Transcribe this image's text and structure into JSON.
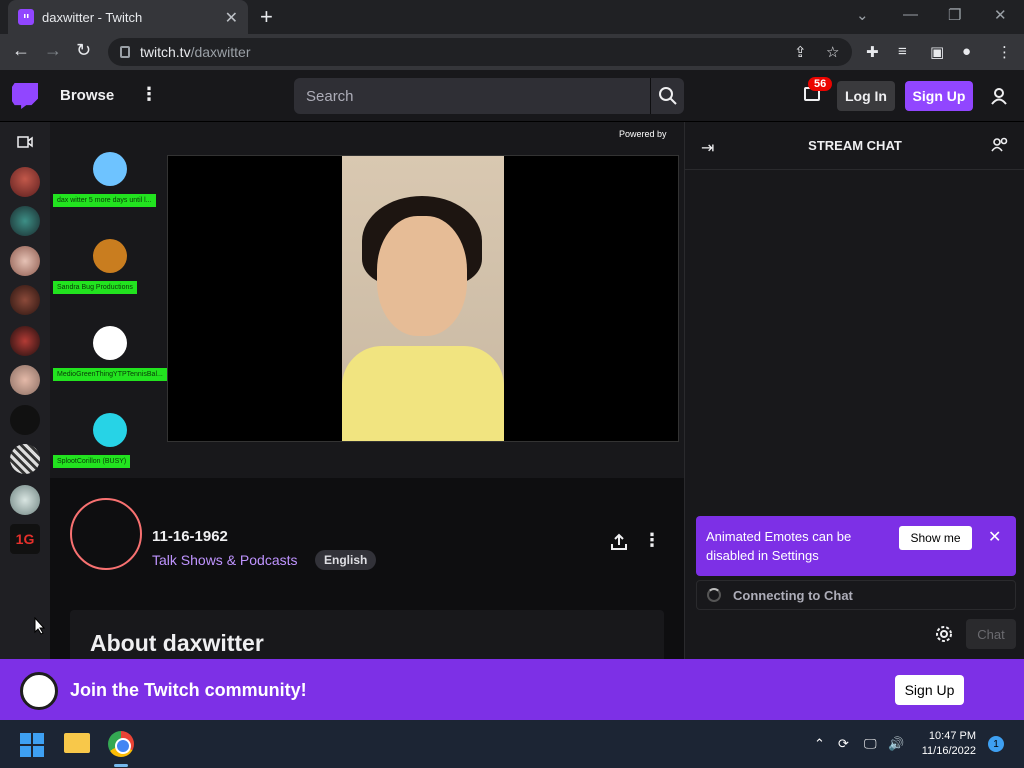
{
  "browser": {
    "tab_title": "daxwitter - Twitch",
    "url_host": "twitch.tv",
    "url_path": "/daxwitter"
  },
  "topnav": {
    "browse_label": "Browse",
    "search_placeholder": "Search",
    "notifications_count": "56",
    "login_label": "Log In",
    "signup_label": "Sign Up"
  },
  "player": {
    "powered_by": "Powered by",
    "overlay_items": [
      {
        "label": "dax witter 5 more days until l...",
        "color": "#6ec3ff"
      },
      {
        "label": "Sandra Bug Productions",
        "color": "#c97d1f"
      },
      {
        "label": "MedioGreenThingYTPTennisBal...",
        "color": "#ffffff"
      },
      {
        "label": "SplootCorillon (BUSY)",
        "color": "#27d3e6"
      }
    ]
  },
  "channel": {
    "title": "11-16-1962",
    "category": "Talk Shows & Podcasts",
    "tag": "English",
    "about_heading": "About daxwitter"
  },
  "chat": {
    "header": "STREAM CHAT",
    "emote_message": "Animated Emotes can be disabled in Settings",
    "show_me_label": "Show me",
    "connecting_label": "Connecting to Chat",
    "chat_button_label": "Chat"
  },
  "join_banner": {
    "text": "Join the Twitch community!",
    "signup_label": "Sign Up"
  },
  "taskbar": {
    "time": "10:47 PM",
    "date": "11/16/2022",
    "notification_count": "1"
  },
  "colors": {
    "twitch_purple": "#9146ff",
    "banner_purple": "#7d30e6",
    "badge_red": "#eb0400"
  }
}
